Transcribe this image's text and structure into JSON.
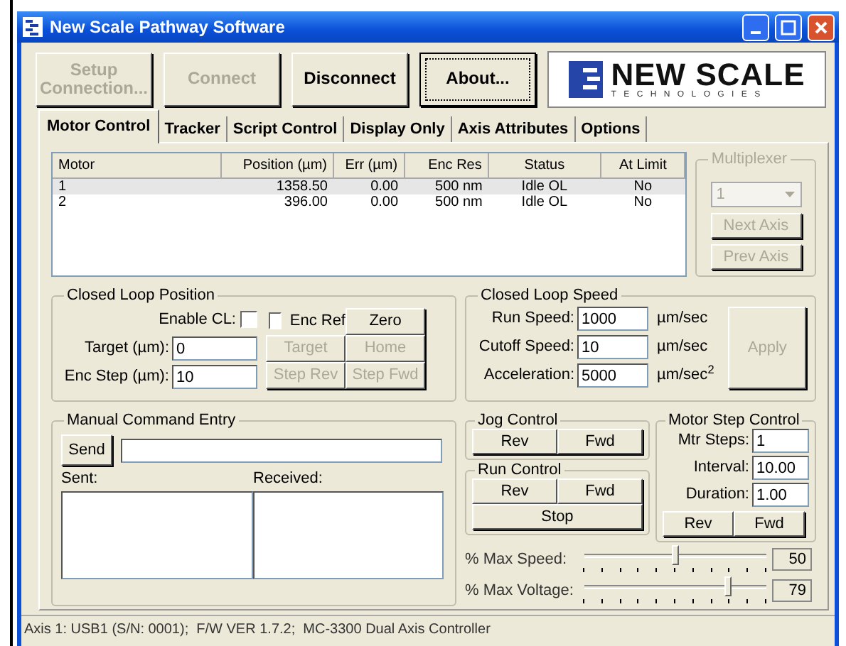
{
  "window": {
    "title": "New Scale Pathway Software"
  },
  "toolbar": [
    {
      "label": "Setup Connection...",
      "disabled": true,
      "focused": false
    },
    {
      "label": "Connect",
      "disabled": true,
      "focused": false
    },
    {
      "label": "Disconnect",
      "disabled": false,
      "focused": false
    },
    {
      "label": "About...",
      "disabled": false,
      "focused": true
    }
  ],
  "logo": {
    "name": "NEW SCALE",
    "tagline": "TECHNOLOGIES"
  },
  "tabs": [
    {
      "label": "Motor Control",
      "selected": true
    },
    {
      "label": "Tracker",
      "selected": false
    },
    {
      "label": "Script Control",
      "selected": false
    },
    {
      "label": "Display Only",
      "selected": false
    },
    {
      "label": "Axis Attributes",
      "selected": false
    },
    {
      "label": "Options",
      "selected": false
    }
  ],
  "motor_table": {
    "columns": [
      "Motor",
      "Position (µm)",
      "Err (µm)",
      "Enc Res",
      "Status",
      "At Limit"
    ],
    "rows": [
      {
        "cells": [
          "1",
          "1358.50",
          "0.00",
          "500 nm",
          "Idle OL",
          "No"
        ],
        "selected": true
      },
      {
        "cells": [
          "2",
          "396.00",
          "0.00",
          "500 nm",
          "Idle OL",
          "No"
        ],
        "selected": false
      }
    ]
  },
  "multiplexer": {
    "title": "Multiplexer",
    "value": "1",
    "disabled": true,
    "buttons": [
      {
        "label": "Next Axis",
        "disabled": true
      },
      {
        "label": "Prev Axis",
        "disabled": true
      }
    ]
  },
  "closed_loop_position": {
    "title": "Closed Loop Position",
    "enable_cl": {
      "label": "Enable CL:",
      "checked": false
    },
    "enc_ref": {
      "label": "Enc Ref",
      "checked": false
    },
    "fields": [
      {
        "label": "Target (µm):",
        "value": "0"
      },
      {
        "label": "Enc Step (µm):",
        "value": "10"
      }
    ],
    "buttons": [
      {
        "label": "Zero",
        "disabled": false
      },
      {
        "label": "Target",
        "disabled": true
      },
      {
        "label": "Home",
        "disabled": true
      },
      {
        "label": "Step Rev",
        "disabled": true
      },
      {
        "label": "Step Fwd",
        "disabled": true
      }
    ]
  },
  "closed_loop_speed": {
    "title": "Closed Loop Speed",
    "fields": [
      {
        "label": "Run Speed:",
        "value": "1000",
        "unit": "µm/sec"
      },
      {
        "label": "Cutoff Speed:",
        "value": "10",
        "unit": "µm/sec"
      },
      {
        "label": "Acceleration:",
        "value": "5000",
        "unit": "µm/sec$^{2}$"
      }
    ],
    "apply": {
      "label": "Apply",
      "disabled": true
    }
  },
  "manual_command": {
    "title": "Manual Command Entry",
    "send": "Send",
    "sent_label": "Sent:",
    "received_label": "Received:"
  },
  "jog_control": {
    "title": "Jog Control",
    "buttons": [
      "Rev",
      "Fwd"
    ]
  },
  "run_control": {
    "title": "Run Control",
    "buttons": [
      "Rev",
      "Fwd",
      "Stop"
    ]
  },
  "motor_step_control": {
    "title": "Motor Step Control",
    "fields": [
      {
        "label": "Mtr Steps:",
        "value": "1"
      },
      {
        "label": "Interval:",
        "value": "10.00"
      },
      {
        "label": "Duration:",
        "value": "1.00"
      }
    ],
    "buttons": [
      "Rev",
      "Fwd"
    ]
  },
  "sliders": [
    {
      "label": "% Max Speed:",
      "level": 0.5,
      "reading": "50"
    },
    {
      "label": "% Max Voltage:",
      "level": 0.79,
      "reading": "79"
    }
  ],
  "status_bar": "Axis 1: USB1 (S/N: 0001);  F/W VER 1.7.2;  MC-3300 Dual Axis Controller"
}
